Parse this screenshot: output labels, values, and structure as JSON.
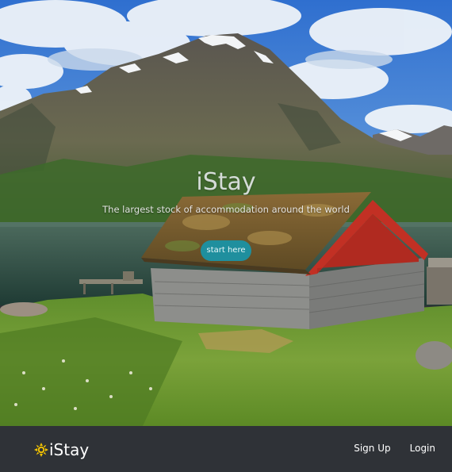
{
  "hero": {
    "title": "iStay",
    "subtitle": "The largest stock of accommodation around the world",
    "cta_label": "start here"
  },
  "footer": {
    "brand_name": "iStay",
    "brand_icon": "sun-logo-icon",
    "nav": [
      {
        "label": "Sign Up"
      },
      {
        "label": "Login"
      }
    ]
  },
  "colors": {
    "cta": "#1f8f9e",
    "footer_bg": "#2f3237",
    "brand_icon": "#f2c200"
  }
}
